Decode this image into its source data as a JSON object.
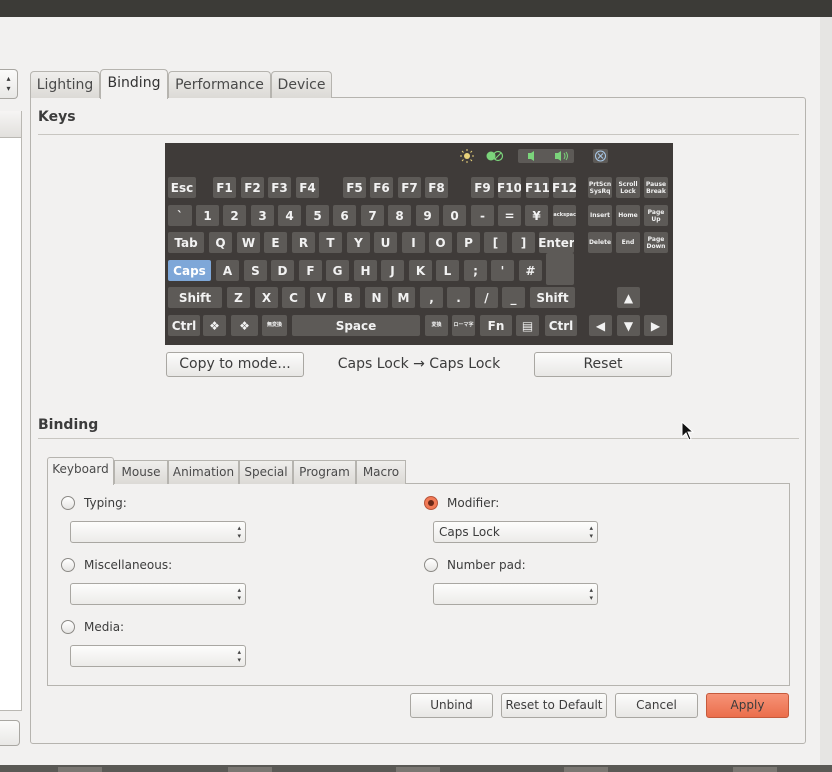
{
  "tabs": [
    "Lighting",
    "Binding",
    "Performance",
    "Device"
  ],
  "keys_section": "Keys",
  "binding_section": "Binding",
  "keyboard": {
    "rows": {
      "fn": [
        "Esc",
        "F1",
        "F2",
        "F3",
        "F4",
        "F5",
        "F6",
        "F7",
        "F8",
        "F9",
        "F10",
        "F11",
        "F12",
        "PrtScn SysRq",
        "Scroll Lock",
        "Pause Break"
      ],
      "num": [
        "`",
        "1",
        "2",
        "3",
        "4",
        "5",
        "6",
        "7",
        "8",
        "9",
        "0",
        "-",
        "=",
        "¥",
        "Backspace",
        "Insert",
        "Home",
        "Page Up"
      ],
      "tab": [
        "Tab",
        "Q",
        "W",
        "E",
        "R",
        "T",
        "Y",
        "U",
        "I",
        "O",
        "P",
        "[",
        "]",
        "Enter",
        "Delete",
        "End",
        "Page Down"
      ],
      "caps": [
        "Caps",
        "A",
        "S",
        "D",
        "F",
        "G",
        "H",
        "J",
        "K",
        "L",
        ";",
        "'",
        "#"
      ],
      "shift": [
        "Shift",
        "Z",
        "X",
        "C",
        "V",
        "B",
        "N",
        "M",
        ",",
        ".",
        "/",
        "_",
        "Shift",
        "▲"
      ],
      "ctrl": [
        "Ctrl",
        "❖",
        "❖",
        "無変換",
        "Space",
        "変換",
        "ローマ字",
        "Fn",
        "▤",
        "Ctrl",
        "◀",
        "▼",
        "▶"
      ]
    },
    "selected_key": "Caps",
    "indicator_colors": {
      "light": "#e8d27a",
      "lock": "#7bd47b",
      "volume": "#7bd47b",
      "mute": "#a8c8e8"
    }
  },
  "copy_button": "Copy to mode...",
  "mapping_text": "Caps Lock → Caps Lock",
  "reset_button": "Reset",
  "subtabs": [
    "Keyboard",
    "Mouse",
    "Animation",
    "Special",
    "Program",
    "Macro"
  ],
  "options": {
    "typing": {
      "label": "Typing:",
      "value": ""
    },
    "misc": {
      "label": "Miscellaneous:",
      "value": ""
    },
    "media": {
      "label": "Media:",
      "value": ""
    },
    "modifier": {
      "label": "Modifier:",
      "value": "Caps Lock",
      "selected": true
    },
    "numpad": {
      "label": "Number pad:",
      "value": ""
    }
  },
  "buttons": {
    "unbind": "Unbind",
    "reset_default": "Reset to Default",
    "cancel": "Cancel",
    "apply": "Apply"
  },
  "colors": {
    "accent": "#ef7452",
    "selected_key": "#7ea7d8",
    "keyboard_bg": "#3f3b39"
  }
}
